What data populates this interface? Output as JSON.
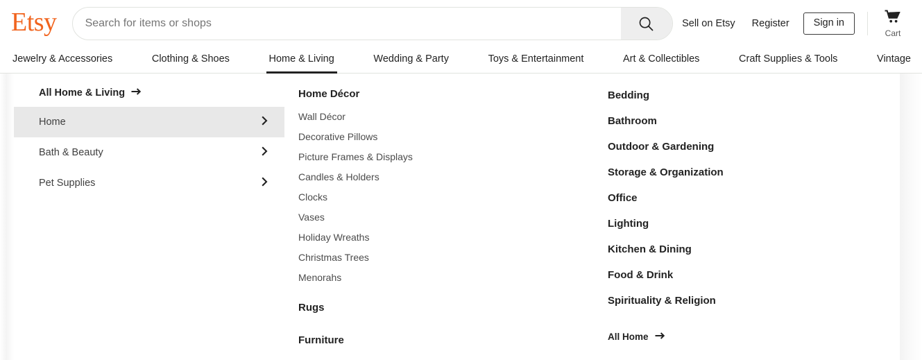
{
  "brand": {
    "logo_text": "Etsy",
    "logo_color": "#f1641e"
  },
  "search": {
    "placeholder": "Search for items or shops",
    "value": "",
    "button_icon": "search-icon"
  },
  "header": {
    "sell_on_etsy": "Sell on Etsy",
    "register": "Register",
    "sign_in": "Sign in",
    "cart_label": "Cart",
    "cart_icon": "shopping-cart-icon"
  },
  "category_nav": {
    "active": "Home & Living",
    "items": [
      {
        "label": "Jewelry & Accessories",
        "active": false
      },
      {
        "label": "Clothing & Shoes",
        "active": false
      },
      {
        "label": "Home & Living",
        "active": true
      },
      {
        "label": "Wedding & Party",
        "active": false
      },
      {
        "label": "Toys & Entertainment",
        "active": false
      },
      {
        "label": "Art & Collectibles",
        "active": false
      },
      {
        "label": "Craft Supplies & Tools",
        "active": false
      },
      {
        "label": "Vintage",
        "active": false
      }
    ]
  },
  "dropdown": {
    "level1": {
      "all_link": "All Home & Living",
      "all_link_icon": "arrow-right-icon",
      "items": [
        {
          "label": "Home",
          "selected": true,
          "icon": "chevron-right-icon"
        },
        {
          "label": "Bath & Beauty",
          "selected": false,
          "icon": "chevron-right-icon"
        },
        {
          "label": "Pet Supplies",
          "selected": false,
          "icon": "chevron-right-icon"
        }
      ]
    },
    "column_middle": {
      "groups": [
        {
          "heading": "Home Décor",
          "links": [
            "Wall Décor",
            "Decorative Pillows",
            "Picture Frames & Displays",
            "Candles & Holders",
            "Clocks",
            "Vases",
            "Holiday Wreaths",
            "Christmas Trees",
            "Menorahs"
          ]
        },
        {
          "heading": "Rugs",
          "links": []
        },
        {
          "heading": "Furniture",
          "links": []
        }
      ]
    },
    "column_right": {
      "groups": [
        {
          "heading": "Bedding"
        },
        {
          "heading": "Bathroom"
        },
        {
          "heading": "Outdoor & Gardening"
        },
        {
          "heading": "Storage & Organization"
        },
        {
          "heading": "Office"
        },
        {
          "heading": "Lighting"
        },
        {
          "heading": "Kitchen & Dining"
        },
        {
          "heading": "Food & Drink"
        },
        {
          "heading": "Spirituality & Religion"
        }
      ],
      "all_link": "All Home",
      "all_link_icon": "arrow-right-icon"
    }
  },
  "colors": {
    "brand_orange": "#f1641e",
    "text_dark": "#222222",
    "text_muted": "#595959",
    "selected_row_bg": "#e8e8e8",
    "border": "#e1e3df"
  }
}
